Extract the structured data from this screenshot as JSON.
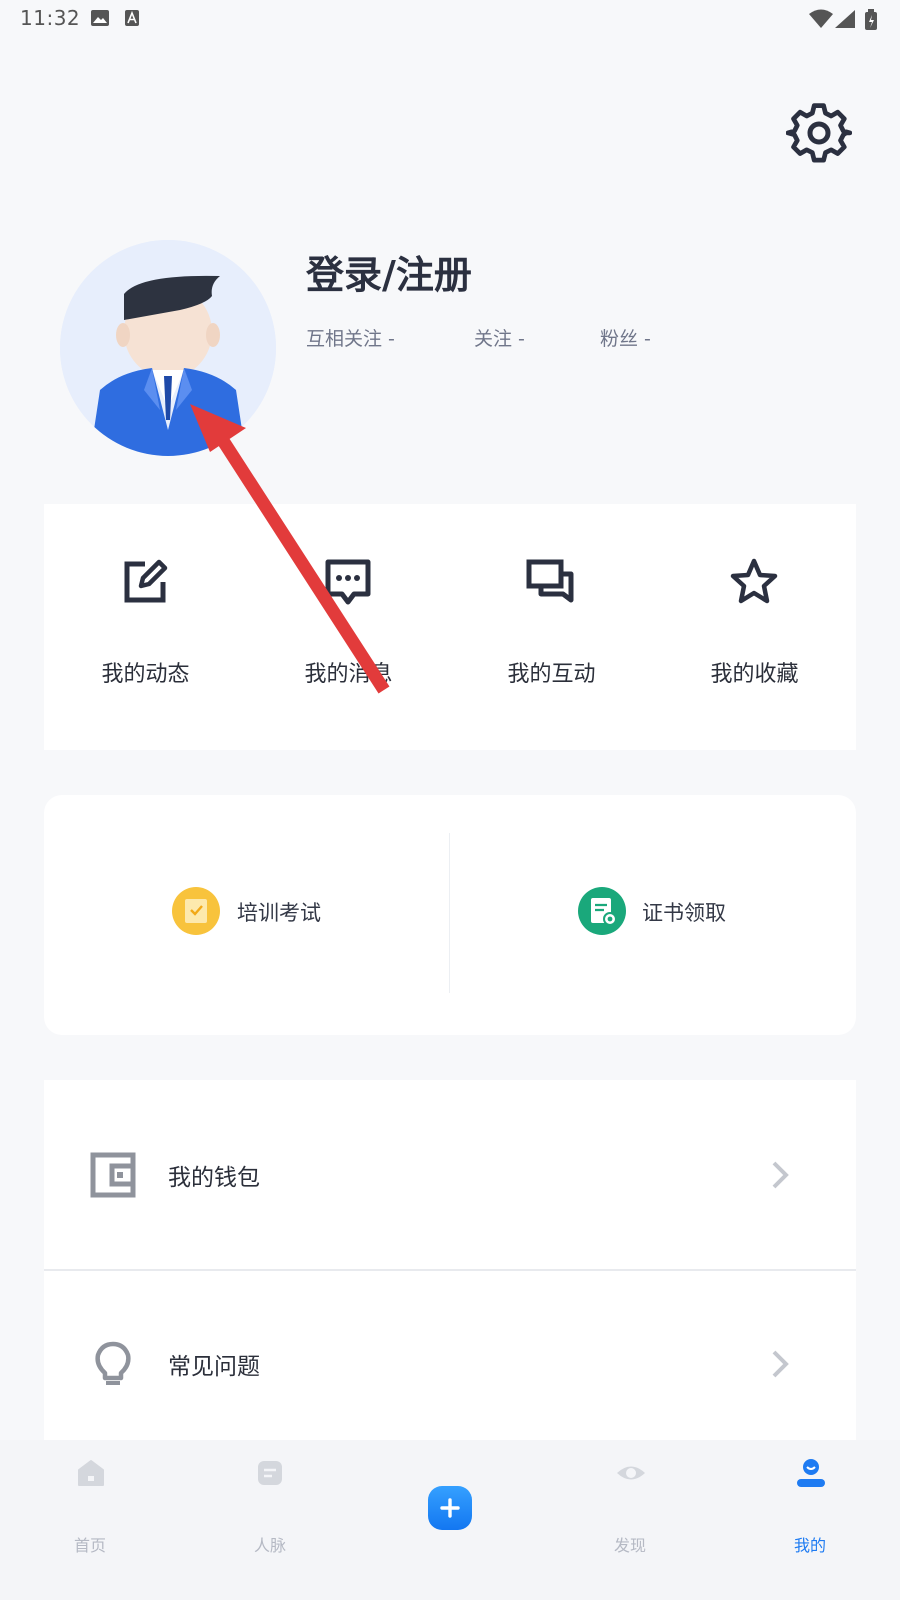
{
  "status_bar": {
    "time": "11:32"
  },
  "profile": {
    "login_label": "登录/注册",
    "stats": [
      {
        "label": "互相关注 -"
      },
      {
        "label": "关注 -"
      },
      {
        "label": "粉丝 -"
      }
    ]
  },
  "quick_actions": [
    {
      "label": "我的动态",
      "icon": "edit-icon"
    },
    {
      "label": "我的消息",
      "icon": "message-icon"
    },
    {
      "label": "我的互动",
      "icon": "chat-icon"
    },
    {
      "label": "我的收藏",
      "icon": "star-icon"
    }
  ],
  "services": [
    {
      "label": "培训考试",
      "icon": "exam-icon",
      "color": "#f8c33c"
    },
    {
      "label": "证书领取",
      "icon": "certificate-icon",
      "color": "#1aa87b"
    }
  ],
  "menu": [
    {
      "label": "我的钱包",
      "icon": "wallet-icon"
    },
    {
      "label": "常见问题",
      "icon": "lightbulb-icon"
    }
  ],
  "tabbar": {
    "tabs": [
      {
        "label": "首页",
        "icon": "home-icon",
        "active": false
      },
      {
        "label": "人脉",
        "icon": "contacts-icon",
        "active": false
      },
      {
        "label": "发现",
        "icon": "eye-icon",
        "active": false
      },
      {
        "label": "我的",
        "icon": "user-icon",
        "active": true
      }
    ]
  },
  "colors": {
    "accent": "#1e7bf2",
    "annotation_arrow": "#e23b3b"
  }
}
